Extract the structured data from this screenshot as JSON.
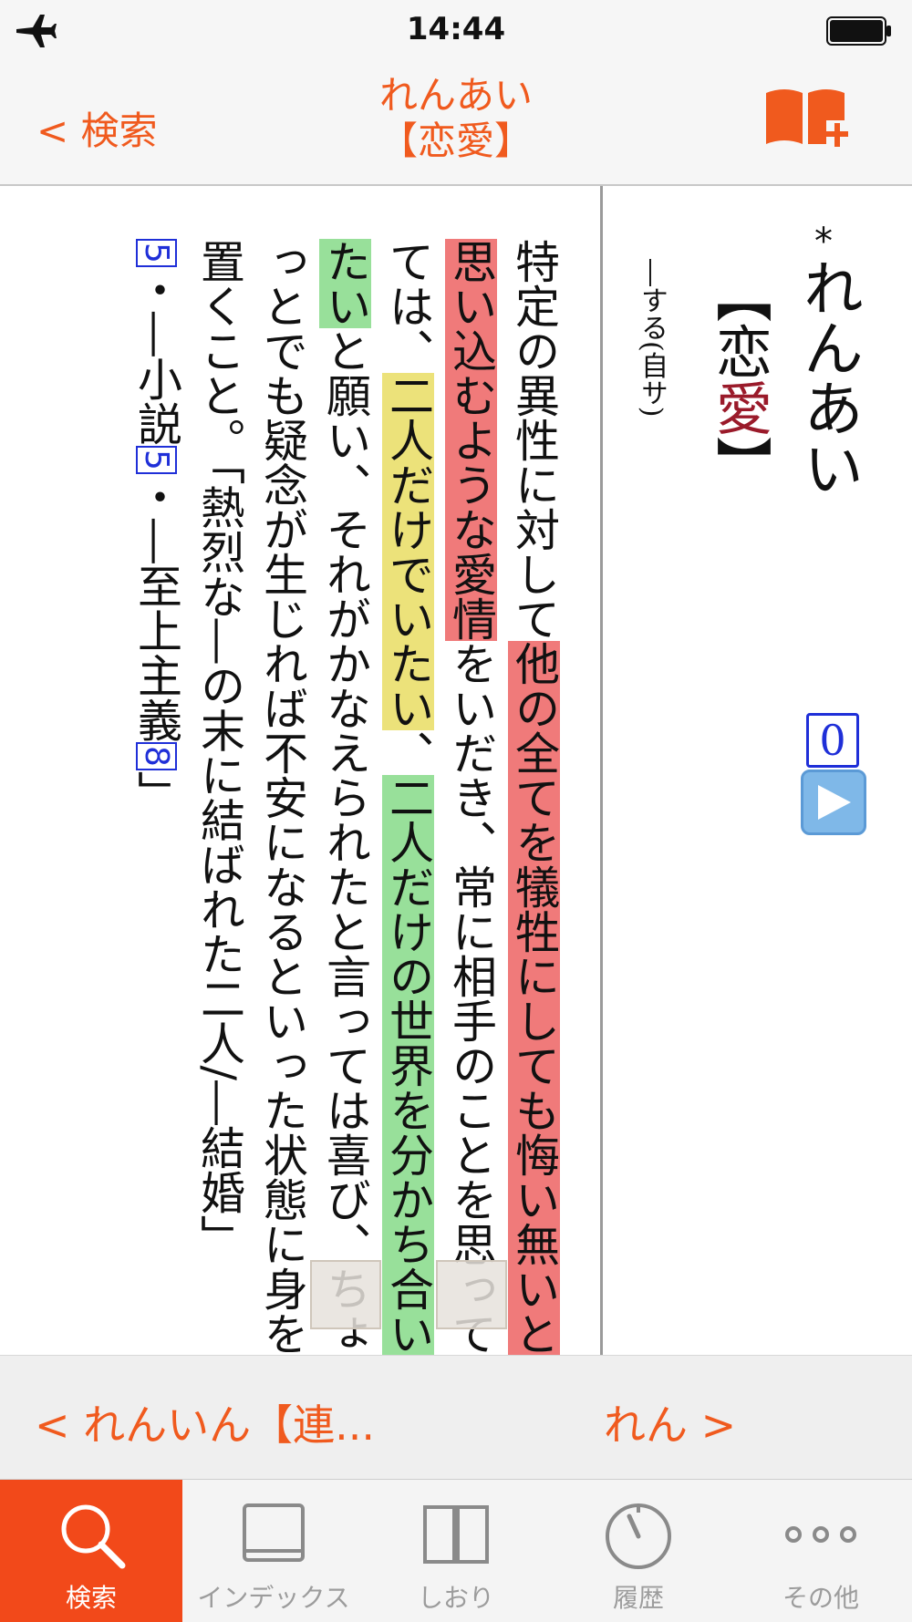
{
  "status": {
    "time": "14:44"
  },
  "nav": {
    "back_label": "< 検索",
    "title_line1": "れんあい",
    "title_line2": "【恋愛】"
  },
  "entry": {
    "mark": "*",
    "headword": "れんあい",
    "kanji_open": "【恋",
    "kanji_red": "愛",
    "kanji_close": "】",
    "usage": "―する(自サ)",
    "accent": "0",
    "definition": {
      "seg1": "特定の異性に対して",
      "seg2": "他の全てを犠牲にしても悔い無い",
      "seg3": "と思い込むような愛情",
      "seg4": "をいだき、常に相手のことを思ってては、",
      "seg5": "二人だけでいたい",
      "seg6": "、",
      "seg7": "二人だけの世界を分かち合いたい",
      "seg8": "と願い、それがかなえられたと言っては喜び、ちょっとでも疑念が生じれば不安になるといった状態に身を置くこと。「熱烈な―の末に結ばれた二人/―結婚」",
      "ref1": "5",
      "ref1_text": "・―小説",
      "ref2": "5",
      "ref2_text": "・―至上主義",
      "ref3": "8",
      "ref3_text": "」"
    }
  },
  "pager": {
    "prev_label": "< れんいん【連...",
    "next_label": "れん >"
  },
  "tabs": [
    {
      "label": "検索",
      "icon": "search-icon",
      "active": true
    },
    {
      "label": "インデックス",
      "icon": "book-icon",
      "active": false
    },
    {
      "label": "しおり",
      "icon": "bookmark-open-book-icon",
      "active": false
    },
    {
      "label": "履歴",
      "icon": "history-dial-icon",
      "active": false
    },
    {
      "label": "その他",
      "icon": "more-dots-icon",
      "active": false
    }
  ],
  "colors": {
    "accent": "#f05a1e",
    "tab_active": "#f2491a",
    "highlight_red": "#f07a7a",
    "highlight_yellow": "#ece27a",
    "highlight_green": "#98e09a",
    "ref_blue": "#1f2fd8"
  }
}
